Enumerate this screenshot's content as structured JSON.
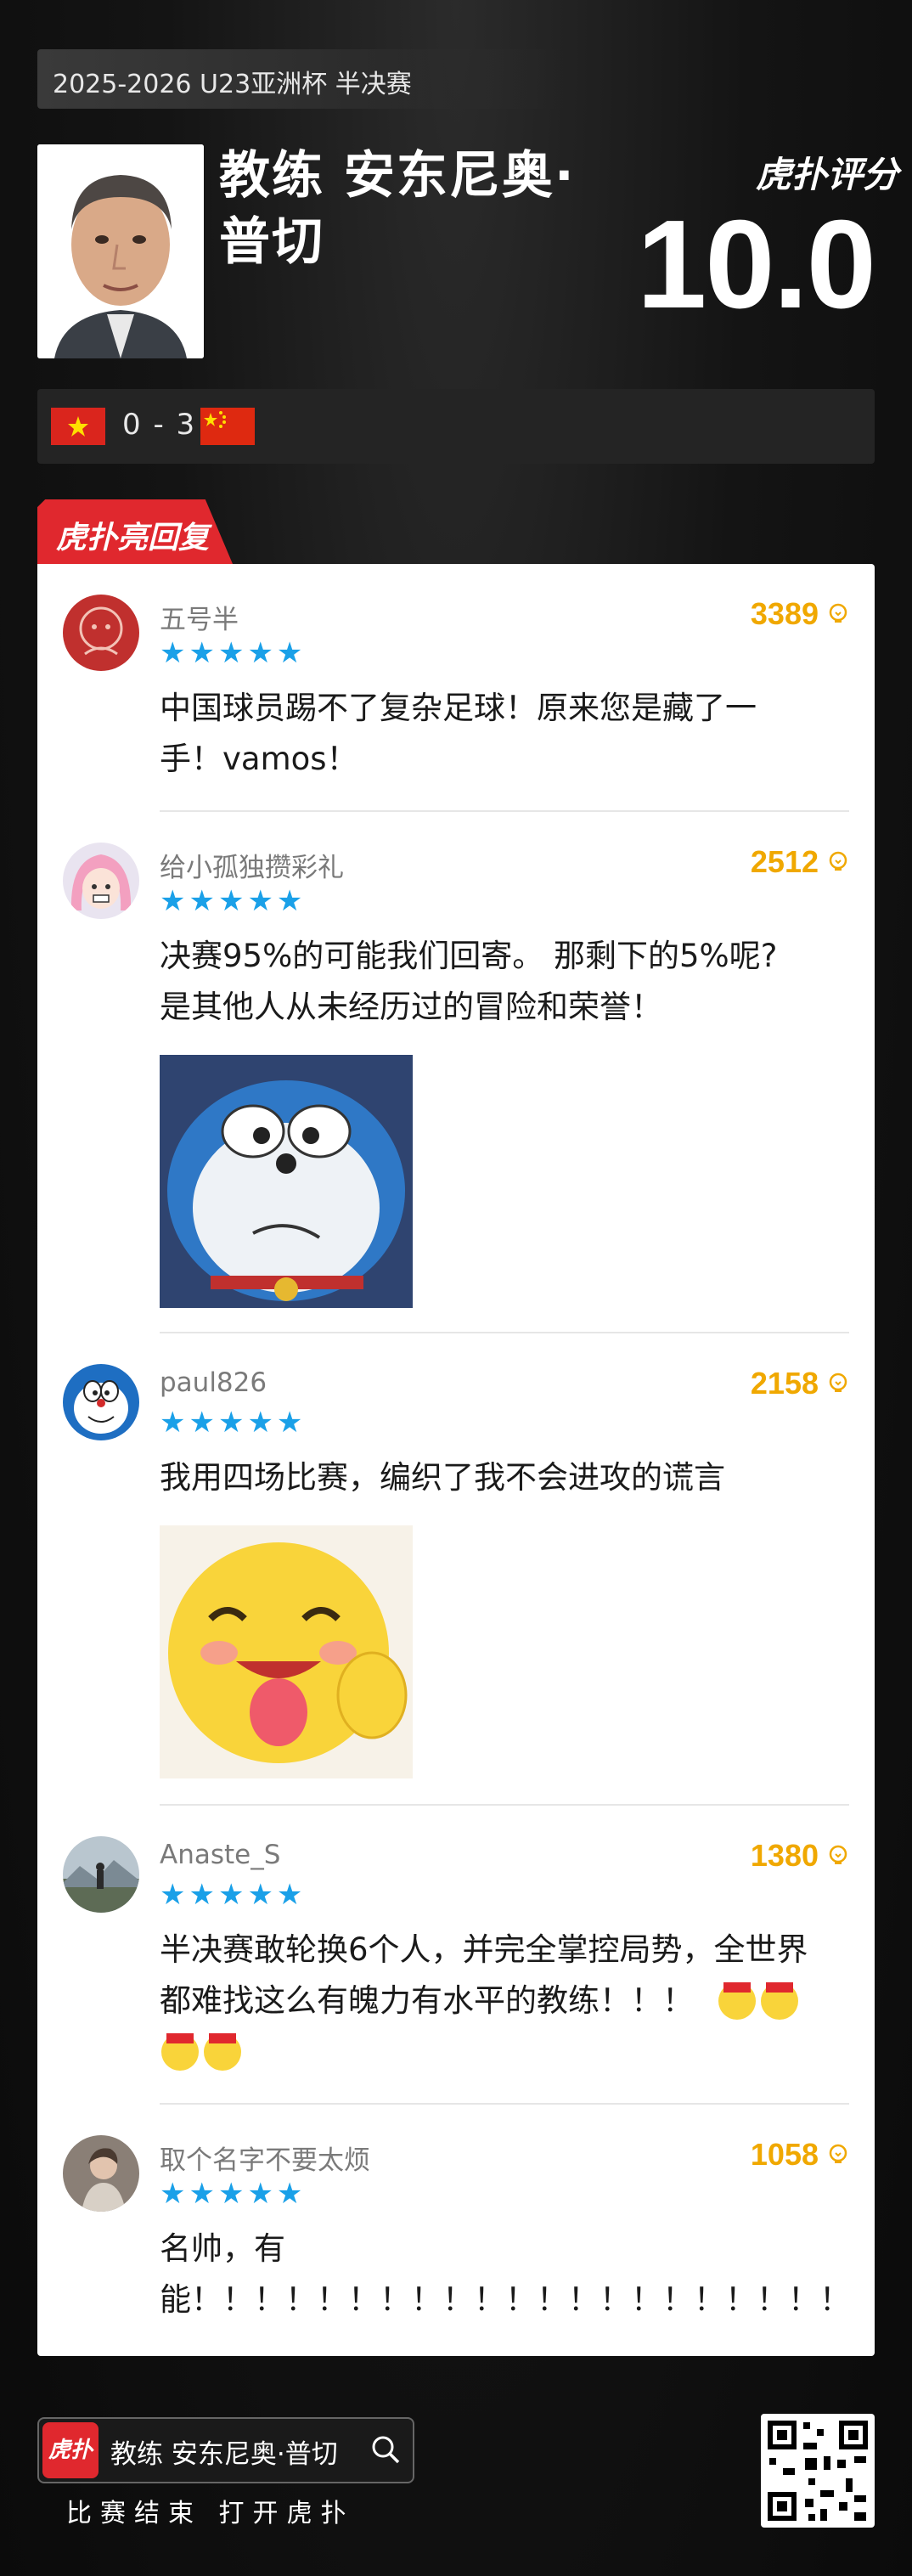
{
  "header": {
    "match_tag": "2025-2026 U23亚洲杯 半决赛",
    "coach_name": "教练 安东尼奥·普切",
    "rating_logo": "虎扑评分",
    "rating_value": "10.0",
    "score": "0 - 3"
  },
  "section": {
    "badge": "虎扑亮回复"
  },
  "comments": [
    {
      "username": "五号半",
      "likes": "3389",
      "stars": "★★★★★",
      "text": "中国球员踢不了复杂足球！原来您是藏了一\n手！vamos！"
    },
    {
      "username": "给小孤独攒彩礼",
      "likes": "2512",
      "stars": "★★★★★",
      "text": "决赛95%的可能我们回寄。 那剩下的5%呢?\n是其他人从未经历过的冒险和荣誉！"
    },
    {
      "username": "paul826",
      "likes": "2158",
      "stars": "★★★★★",
      "text": "我用四场比赛，编织了我不会进攻的谎言"
    },
    {
      "username": "Anaste_S",
      "likes": "1380",
      "stars": "★★★★★",
      "text": "半决赛敢轮换6个人，并完全掌控局势，全世界\n都难找这么有魄力有水平的教练！！！"
    },
    {
      "username": "取个名字不要太烦",
      "likes": "1058",
      "stars": "★★★★★",
      "text": "名帅，有\n能！！！！！！！！！！！！！！！！！！！！！"
    }
  ],
  "footer": {
    "search_text": "教练 安东尼奥·普切",
    "app_logo": "虎扑",
    "tagline": "比赛结束 打开虎扑"
  },
  "colors": {
    "accent_red": "#e0282e",
    "likes_gold": "#f0a800",
    "star_blue": "#1aa0e8"
  }
}
